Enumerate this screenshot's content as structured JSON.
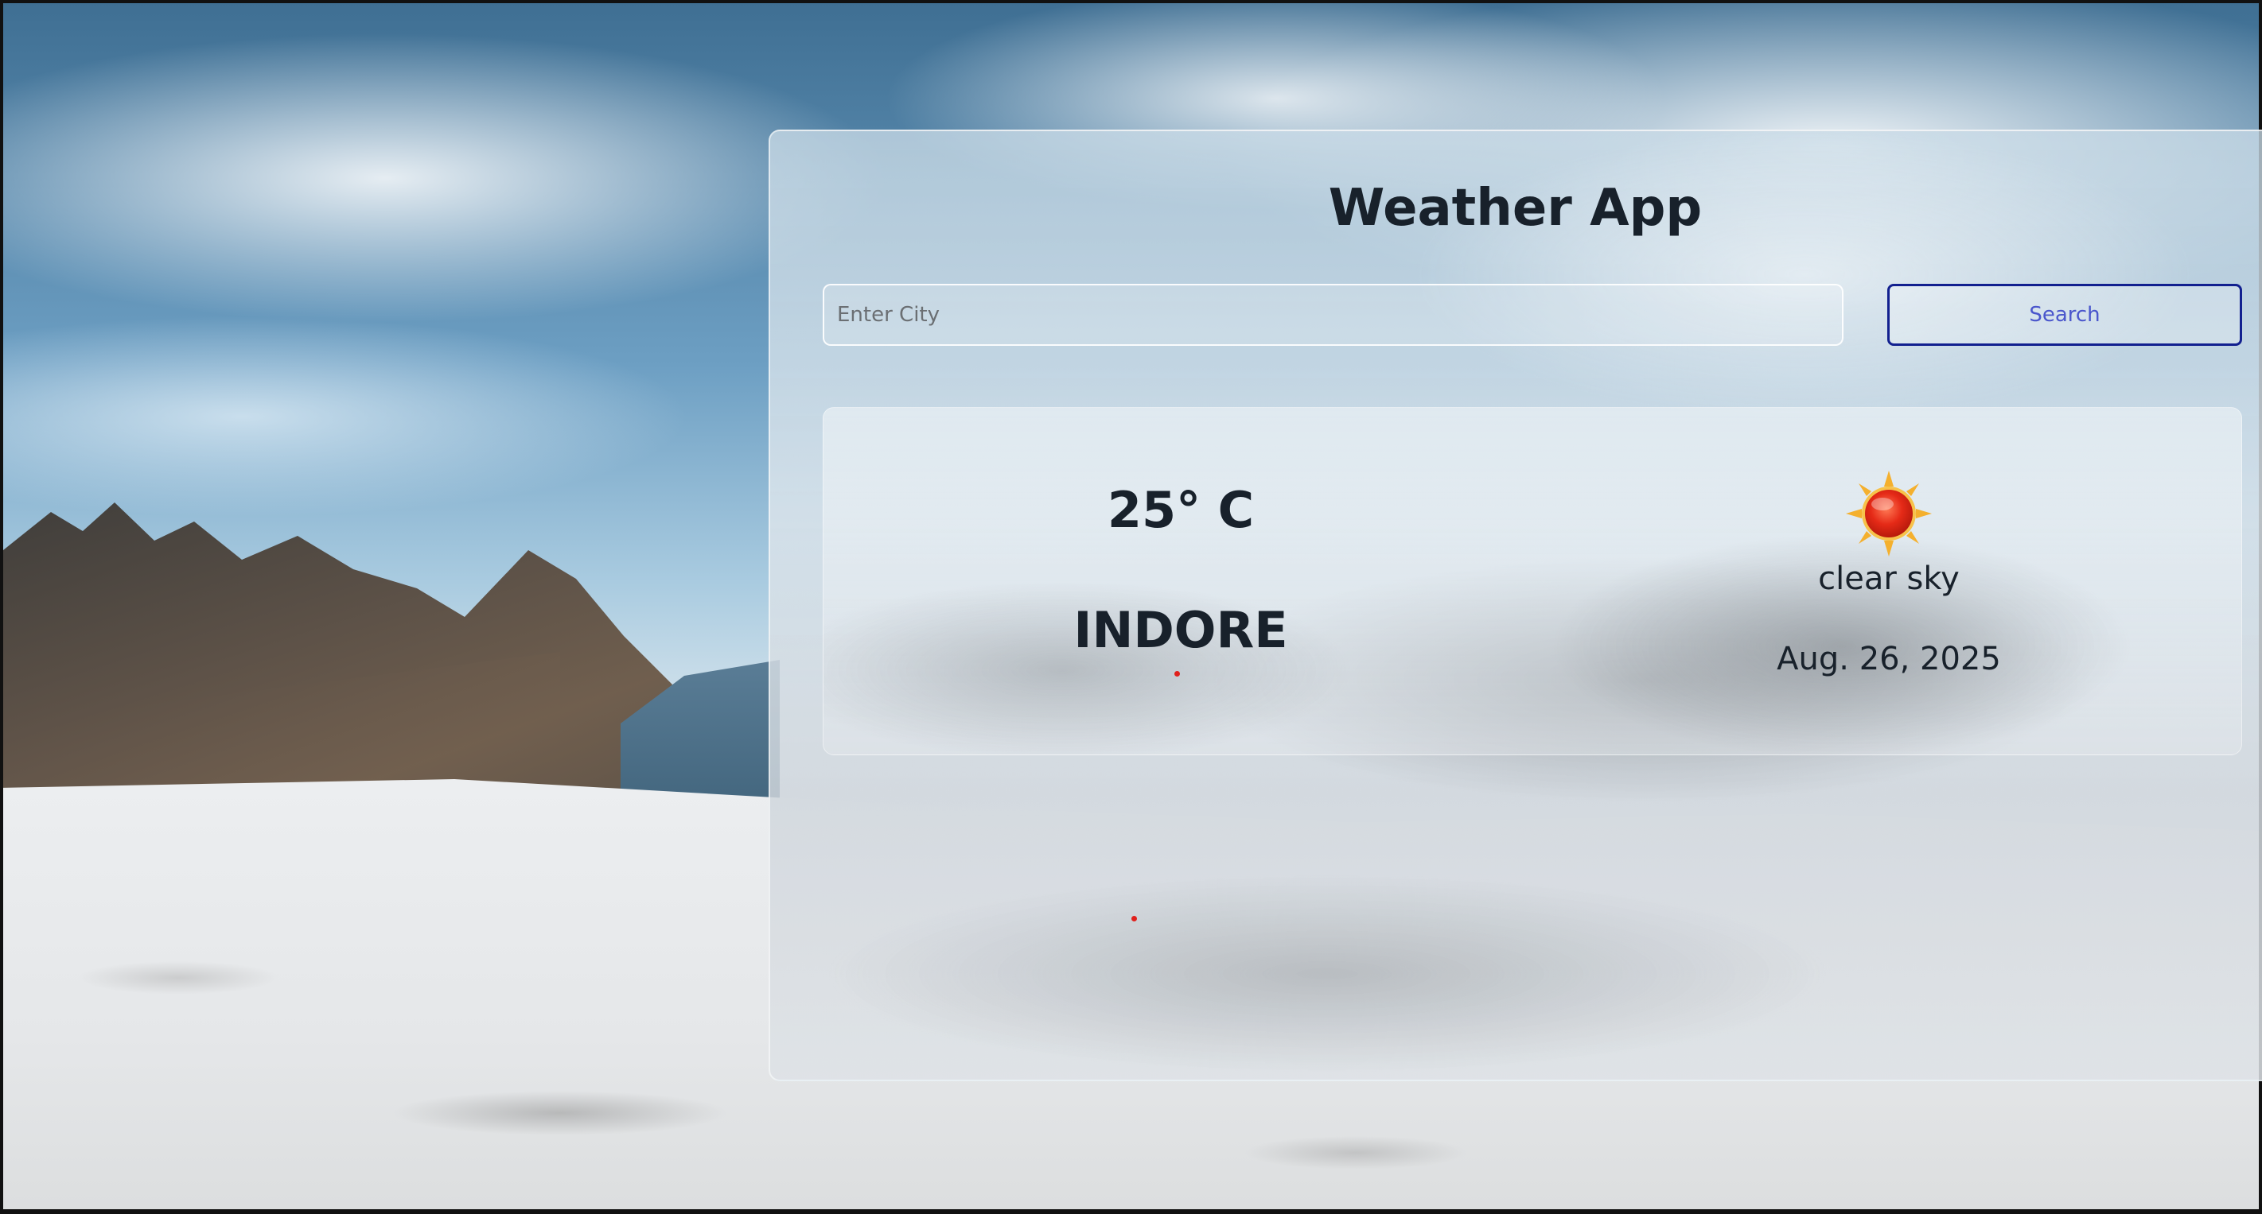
{
  "app": {
    "title": "Weather App"
  },
  "search": {
    "placeholder": "Enter City",
    "value": "",
    "button_label": "Search"
  },
  "weather": {
    "temperature": "25° C",
    "city": "INDORE",
    "icon": "sun-icon",
    "description": "clear sky",
    "date": "Aug. 26, 2025"
  },
  "colors": {
    "text": "#18212b",
    "button_border": "#12208f",
    "button_text": "#4a56cc",
    "marker": "#e0201c"
  }
}
